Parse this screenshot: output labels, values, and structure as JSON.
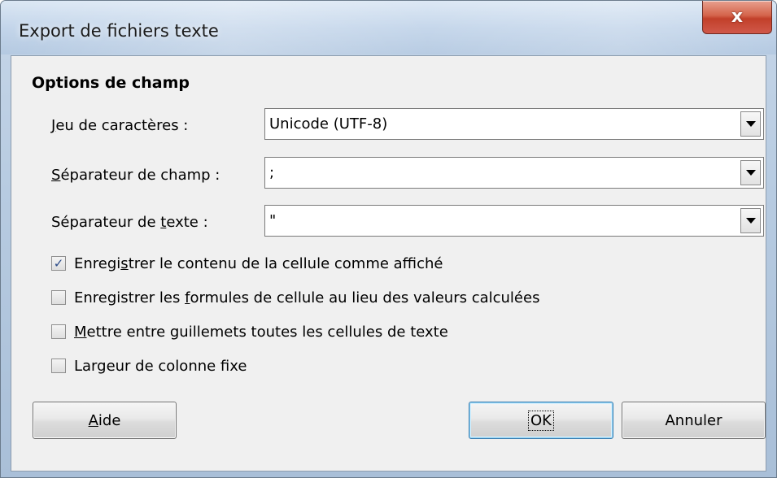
{
  "window": {
    "title": "Export de fichiers texte",
    "close_glyph": "x"
  },
  "section": {
    "title": "Options de champ"
  },
  "fields": [
    {
      "label_ul": "J",
      "label_rest": "eu de caractères :",
      "value": "Unicode (UTF-8)"
    },
    {
      "label_ul": "S",
      "label_rest": "éparateur de champ :",
      "value": ";"
    },
    {
      "label_pre": "Séparateur de ",
      "label_ul": "t",
      "label_rest": "exte :",
      "value": "\""
    }
  ],
  "options": [
    {
      "checked": true,
      "pre": "Enregi",
      "ul": "s",
      "post": "trer le contenu de la cellule comme affiché"
    },
    {
      "checked": false,
      "pre": "Enregistrer les ",
      "ul": "f",
      "post": "ormules de cellule au lieu des valeurs calculées"
    },
    {
      "checked": false,
      "pre": "",
      "ul": "M",
      "post": "ettre entre guillemets toutes les cellules de texte"
    },
    {
      "checked": false,
      "pre": "Largeur de colonne f",
      "ul": "i",
      "post": "xe"
    }
  ],
  "buttons": {
    "help_ul": "A",
    "help_rest": "ide",
    "ok": "OK",
    "cancel": "Annuler"
  },
  "icons": {
    "check": "✓",
    "dropdown": "chevron-down-icon"
  }
}
